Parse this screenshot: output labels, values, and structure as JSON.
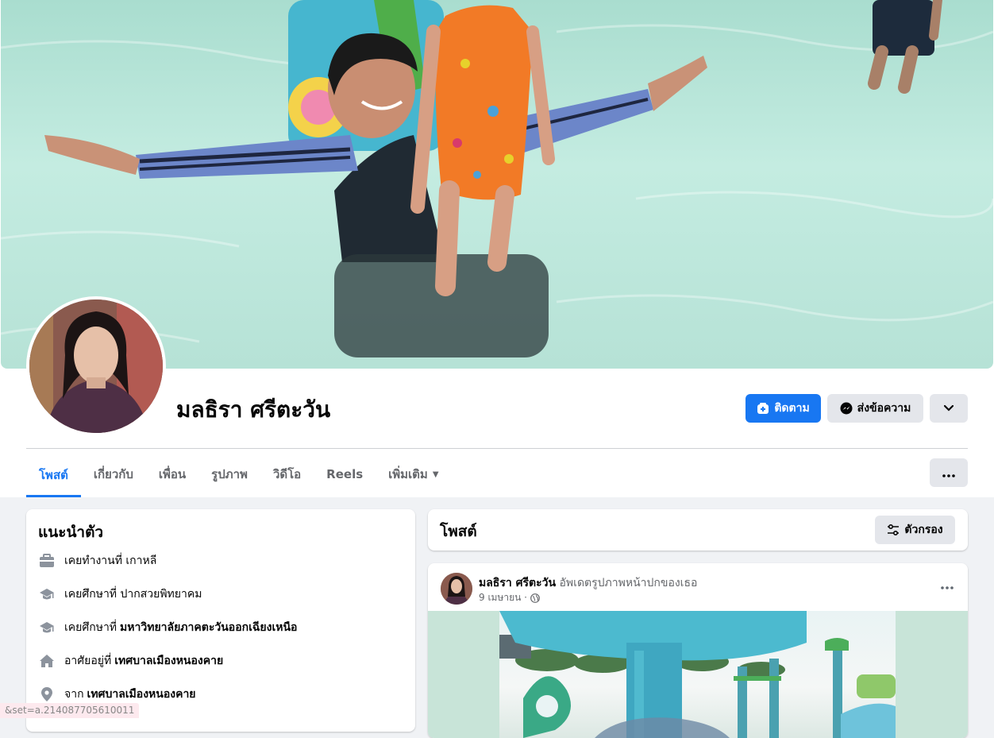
{
  "profile": {
    "name": "มลธิรา ศรีตะวัน"
  },
  "actions": {
    "follow_label": "ติดตาม",
    "message_label": "ส่งข้อความ"
  },
  "tabs": [
    {
      "label": "โพสต์"
    },
    {
      "label": "เกี่ยวกับ"
    },
    {
      "label": "เพื่อน"
    },
    {
      "label": "รูปภาพ"
    },
    {
      "label": "วิดีโอ"
    },
    {
      "label": "Reels"
    },
    {
      "label": "เพิ่มเติม"
    }
  ],
  "intro": {
    "title": "แนะนำตัว",
    "items": [
      {
        "icon": "briefcase-icon",
        "prefix": "เคยทำงานที่ เกาหลี",
        "strong": ""
      },
      {
        "icon": "graduation-cap-icon",
        "prefix": "เคยศึกษาที่ ปากสวยพิทยาคม",
        "strong": ""
      },
      {
        "icon": "graduation-cap-icon",
        "prefix": "เคยศึกษาที่",
        "strong": "มหาวิทยาลัยภาคตะวันออกเฉียงเหนือ"
      },
      {
        "icon": "home-icon",
        "prefix": "อาศัยอยู่ที่",
        "strong": "เทศบาลเมืองหนองคาย"
      },
      {
        "icon": "location-pin-icon",
        "prefix": "จาก",
        "strong": "เทศบาลเมืองหนองคาย"
      }
    ]
  },
  "posts_header": {
    "title": "โพสต์",
    "filter_label": "ตัวกรอง"
  },
  "post": {
    "author": "มลธิรา ศรีตะวัน",
    "action": "อัพเดตรูปภาพหน้าปกของเธอ",
    "date": "9 เมษายน ·"
  },
  "status_bar": {
    "text": "&set=a.214087705610011"
  },
  "colors": {
    "accent": "#1877f2",
    "background": "#f0f2f5",
    "button_gray": "#e4e6eb"
  }
}
